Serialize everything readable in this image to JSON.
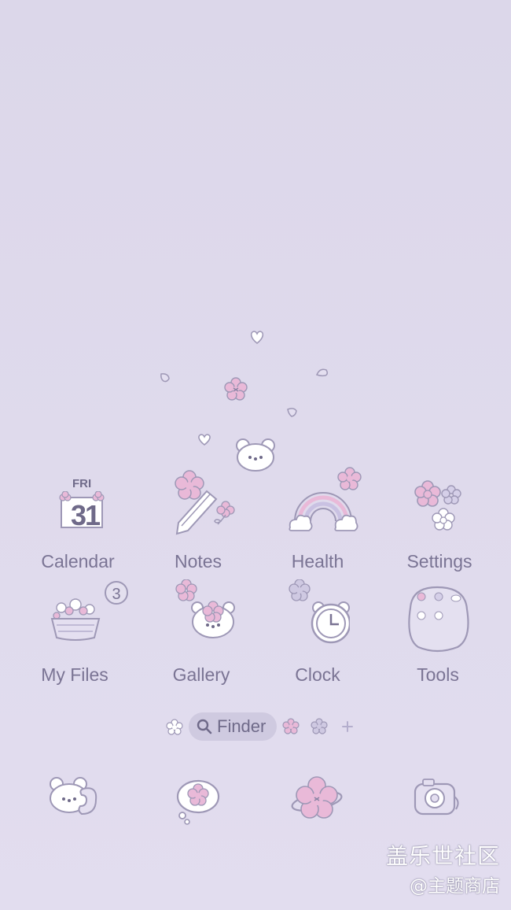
{
  "colors": {
    "background": "#dedaec",
    "label": "#7a7494",
    "line": "#9e98b6",
    "pink": "#e9b9d8",
    "white": "#ffffff"
  },
  "apps": [
    {
      "label": "Calendar",
      "icon": "calendar-icon"
    },
    {
      "label": "Notes",
      "icon": "notes-pencil-icon"
    },
    {
      "label": "Health",
      "icon": "rainbow-icon"
    },
    {
      "label": "Settings",
      "icon": "flowers-settings-icon"
    },
    {
      "label": "My Files",
      "icon": "flower-basket-icon"
    },
    {
      "label": "Gallery",
      "icon": "bear-gallery-icon"
    },
    {
      "label": "Clock",
      "icon": "clock-icon"
    },
    {
      "label": "Tools",
      "icon": "tools-folder-icon"
    }
  ],
  "calendar": {
    "day": "FRI",
    "date": "31"
  },
  "my_files_badge": "3",
  "finder": {
    "label": "Finder",
    "icon": "search-icon"
  },
  "dock": [
    {
      "icon": "bear-phone-icon"
    },
    {
      "icon": "speech-bubble-icon"
    },
    {
      "icon": "planet-flower-icon"
    },
    {
      "icon": "camera-icon"
    }
  ],
  "watermark": {
    "line1": "盖乐世社区",
    "line2": "@主题商店"
  }
}
